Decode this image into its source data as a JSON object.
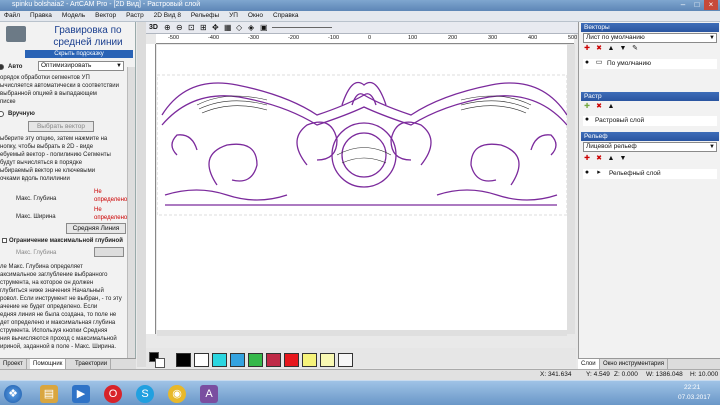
{
  "window": {
    "title": "spinku bolshaia2 - ArtCAM Pro - [2D Вид] - Растровый слой"
  },
  "menu": [
    "Файл",
    "Правка",
    "Модель",
    "Вектор",
    "Растр",
    "2D Вид 8",
    "Рельефы",
    "УП",
    "Окно",
    "Справка"
  ],
  "left": {
    "title_line1": "Гравировка по",
    "title_line2": "средней линии",
    "subtitle": "Скрыть подсказку",
    "auto_label": "Авто",
    "auto_mode": "Оптимизировать",
    "auto_help": [
      "орядок обработки сегментов УП",
      "ычисляется автоматически в соответствии",
      "выбранной опцией в выпадающем",
      "писке"
    ],
    "manual_label": "Вручную",
    "select_vector_button": "Выбрать вектор",
    "manual_help": [
      "ыберите эту опцию, затем нажмите на",
      "нопку, чтобы выбрать в 2D - виде",
      "ебуемый вектор - полилинию Сегменты",
      "будут вычисляться в порядке",
      "ыбираемый вектор не ключевыми",
      "очками вдоль полилинии"
    ],
    "max_depth_label": "Макс. Глубина",
    "max_width_label": "Макс. Ширина",
    "not_defined_1": "Не определено",
    "not_defined_2": "Не определено",
    "midline_button": "Средняя Линия",
    "limit_depth_label": "Ограничение максимальной глубиной",
    "depth_label": "Макс. Глубина",
    "help_lines": [
      "ле Макс. Глубина определяет",
      "аксимальное заглубление выбранного",
      "струмента, на которое он должен",
      "глубиться ниже значения Начальный",
      "ровол. Если инструмент не выбран, - то эту",
      "ачение не будет определено. Если",
      "едняя линия не была создана, то поле не",
      "дет определено и максимальная глубина",
      "струмента. Используя кнопки Средняя",
      "ния вычисляются проход с максимальной",
      "ириной, заданной в поле - Макс. Ширина."
    ],
    "tabs": [
      "Проект",
      "Помощник",
      "Траектории"
    ]
  },
  "ruler": {
    "labels": [
      "-500",
      "-400",
      "-300",
      "-200",
      "-100",
      "0",
      "100",
      "200",
      "300",
      "400",
      "500"
    ]
  },
  "view_toolbar": {
    "mode": "3D"
  },
  "palette": {
    "colors": [
      "#000000",
      "#ffffff",
      "#2bd6e0",
      "#34a3e0",
      "#36b84a",
      "#bf2a47",
      "#e6171c",
      "#f6f37a",
      "#f9f9b3",
      "#f6f6f6"
    ]
  },
  "right": {
    "vectors_header": "Векторы",
    "vectors_sheet": "Лист по умолчанию",
    "vectors_layer": "По умолчанию",
    "raster_header": "Растр",
    "raster_layer": "Растровый слой",
    "relief_header": "Рельеф",
    "relief_layer_set": "Лицевой рельеф",
    "relief_layer": "Рельефный слой",
    "tabs": [
      "Слои",
      "Окно инструментария"
    ]
  },
  "status": {
    "x": "X: 341.634",
    "y": "Y: 4.549",
    "z": "Z: 0.000",
    "w": "W: 1386.048",
    "h": "H: 10.000"
  },
  "taskbar": {
    "time": "22:21",
    "date": "07.03.2017"
  },
  "icons": [
    "start-orb",
    "explorer-icon",
    "media-icon",
    "opera-icon",
    "skype-icon",
    "chrome-icon",
    "artcam-icon"
  ]
}
